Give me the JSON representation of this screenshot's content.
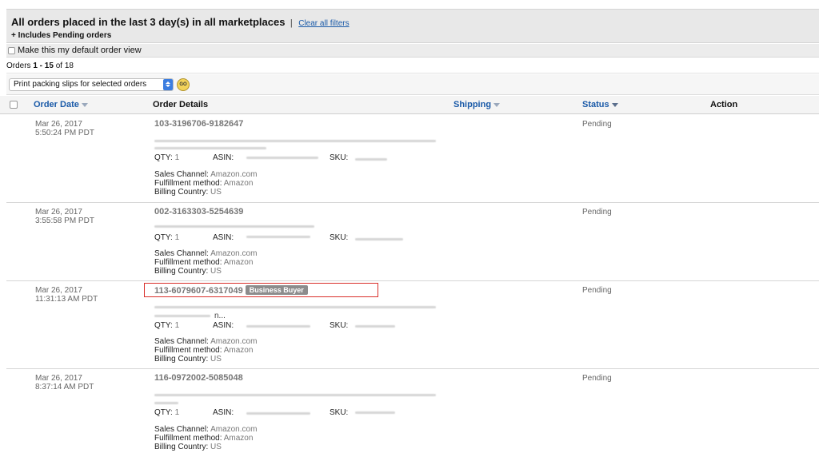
{
  "header": {
    "title": "All orders placed in the last 3 day(s) in all marketplaces",
    "separator": "|",
    "clear_filters": "Clear all filters",
    "subtitle": "+ Includes Pending orders"
  },
  "default_view_label": "Make this my default order view",
  "count": {
    "prefix": "Orders ",
    "range": "1 - 15",
    "of": " of ",
    "total": "18"
  },
  "action_bar": {
    "select_value": "Print packing slips for selected orders",
    "go_label": "GO"
  },
  "columns": {
    "order_date": "Order Date",
    "order_details": "Order Details",
    "shipping": "Shipping",
    "status": "Status",
    "action": "Action"
  },
  "labels": {
    "qty": "QTY:",
    "asin": "ASIN:",
    "sku": "SKU:",
    "sales_channel": "Sales Channel:",
    "fulfillment": "Fulfillment method:",
    "billing_country": "Billing Country:"
  },
  "orders": [
    {
      "date": "Mar 26, 2017",
      "time": "5:50:24 PM PDT",
      "order_id": "103-3196706-9182647",
      "qty": "1",
      "sales_channel": "Amazon.com",
      "fulfillment": "Amazon",
      "billing_country": "US",
      "status": "Pending"
    },
    {
      "date": "Mar 26, 2017",
      "time": "3:55:58 PM PDT",
      "order_id": "002-3163303-5254639",
      "qty": "1",
      "sales_channel": "Amazon.com",
      "fulfillment": "Amazon",
      "billing_country": "US",
      "status": "Pending"
    },
    {
      "date": "Mar 26, 2017",
      "time": "11:31:13 AM PDT",
      "order_id": "113-6079607-6317049",
      "badge": "Business Buyer",
      "title_fragment": "n...",
      "qty": "1",
      "sales_channel": "Amazon.com",
      "fulfillment": "Amazon",
      "billing_country": "US",
      "status": "Pending"
    },
    {
      "date": "Mar 26, 2017",
      "time": "8:37:14 AM PDT",
      "order_id": "116-0972002-5085048",
      "qty": "1",
      "sales_channel": "Amazon.com",
      "fulfillment": "Amazon",
      "billing_country": "US",
      "status": "Pending"
    }
  ]
}
